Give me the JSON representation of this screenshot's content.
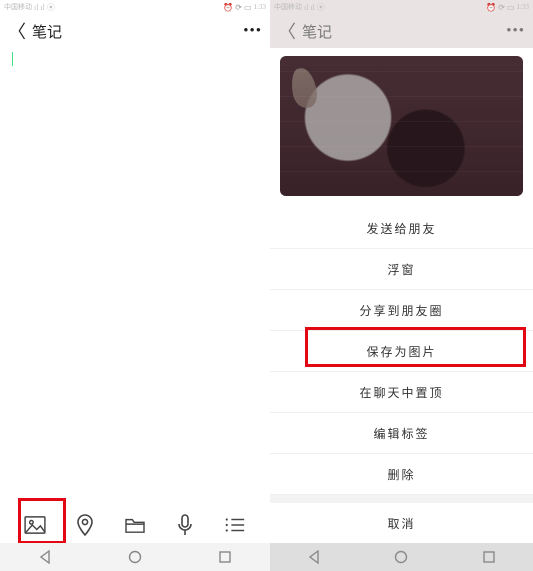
{
  "left": {
    "status": {
      "time": "1:33",
      "batt": "100",
      "carrier": "中国移动"
    },
    "header": {
      "title": "笔记"
    },
    "note_text": ""
  },
  "right": {
    "status": {
      "time": "1:33",
      "batt": "100",
      "carrier": "中国移动"
    },
    "header": {
      "title": "笔记"
    }
  },
  "sheet": {
    "items": [
      "发送给朋友",
      "浮窗",
      "分享到朋友圈",
      "保存为图片",
      "在聊天中置顶",
      "编辑标签",
      "删除"
    ],
    "cancel": "取消"
  }
}
